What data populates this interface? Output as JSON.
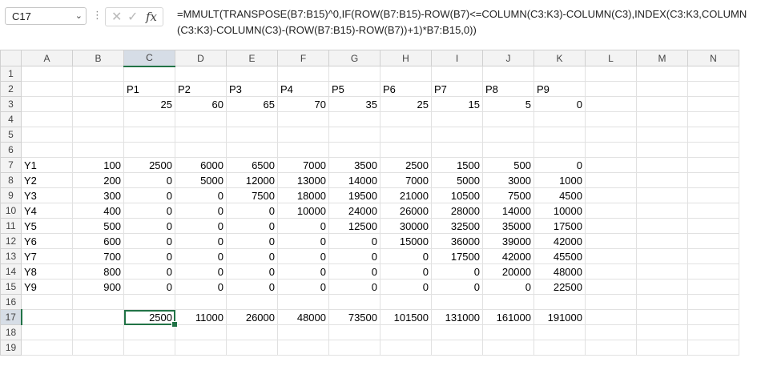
{
  "formula_bar": {
    "name_box": "C17",
    "formula": "=MMULT(TRANSPOSE(B7:B15)^0,IF(ROW(B7:B15)-ROW(B7)<=COLUMN(C3:K3)-COLUMN(C3),INDEX(C3:K3,COLUMN(C3:K3)-COLUMN(C3)-(ROW(B7:B15)-ROW(B7))+1)*B7:B15,0))",
    "fx_label": "fx",
    "cancel_glyph": "✕",
    "enter_glyph": "✓"
  },
  "sheet": {
    "active_cell": "C17",
    "column_headers": [
      "A",
      "B",
      "C",
      "D",
      "E",
      "F",
      "G",
      "H",
      "I",
      "J",
      "K",
      "L",
      "M",
      "N"
    ],
    "rows": [
      {
        "n": "1",
        "cells": [
          "",
          "",
          "",
          "",
          "",
          "",
          "",
          "",
          "",
          "",
          "",
          "",
          "",
          ""
        ]
      },
      {
        "n": "2",
        "cells": [
          "",
          "",
          "P1",
          "P2",
          "P3",
          "P4",
          "P5",
          "P6",
          "P7",
          "P8",
          "P9",
          "",
          "",
          ""
        ]
      },
      {
        "n": "3",
        "cells": [
          "",
          "",
          "25",
          "60",
          "65",
          "70",
          "35",
          "25",
          "15",
          "5",
          "0",
          "",
          "",
          ""
        ]
      },
      {
        "n": "4",
        "cells": [
          "",
          "",
          "",
          "",
          "",
          "",
          "",
          "",
          "",
          "",
          "",
          "",
          "",
          ""
        ]
      },
      {
        "n": "5",
        "cells": [
          "",
          "",
          "",
          "",
          "",
          "",
          "",
          "",
          "",
          "",
          "",
          "",
          "",
          ""
        ]
      },
      {
        "n": "6",
        "cells": [
          "",
          "",
          "",
          "",
          "",
          "",
          "",
          "",
          "",
          "",
          "",
          "",
          "",
          ""
        ]
      },
      {
        "n": "7",
        "cells": [
          "Y1",
          "100",
          "2500",
          "6000",
          "6500",
          "7000",
          "3500",
          "2500",
          "1500",
          "500",
          "0",
          "",
          "",
          ""
        ]
      },
      {
        "n": "8",
        "cells": [
          "Y2",
          "200",
          "0",
          "5000",
          "12000",
          "13000",
          "14000",
          "7000",
          "5000",
          "3000",
          "1000",
          "",
          "",
          ""
        ]
      },
      {
        "n": "9",
        "cells": [
          "Y3",
          "300",
          "0",
          "0",
          "7500",
          "18000",
          "19500",
          "21000",
          "10500",
          "7500",
          "4500",
          "",
          "",
          ""
        ]
      },
      {
        "n": "10",
        "cells": [
          "Y4",
          "400",
          "0",
          "0",
          "0",
          "10000",
          "24000",
          "26000",
          "28000",
          "14000",
          "10000",
          "",
          "",
          ""
        ]
      },
      {
        "n": "11",
        "cells": [
          "Y5",
          "500",
          "0",
          "0",
          "0",
          "0",
          "12500",
          "30000",
          "32500",
          "35000",
          "17500",
          "",
          "",
          ""
        ]
      },
      {
        "n": "12",
        "cells": [
          "Y6",
          "600",
          "0",
          "0",
          "0",
          "0",
          "0",
          "15000",
          "36000",
          "39000",
          "42000",
          "",
          "",
          ""
        ]
      },
      {
        "n": "13",
        "cells": [
          "Y7",
          "700",
          "0",
          "0",
          "0",
          "0",
          "0",
          "0",
          "17500",
          "42000",
          "45500",
          "",
          "",
          ""
        ]
      },
      {
        "n": "14",
        "cells": [
          "Y8",
          "800",
          "0",
          "0",
          "0",
          "0",
          "0",
          "0",
          "0",
          "20000",
          "48000",
          "",
          "",
          ""
        ]
      },
      {
        "n": "15",
        "cells": [
          "Y9",
          "900",
          "0",
          "0",
          "0",
          "0",
          "0",
          "0",
          "0",
          "0",
          "22500",
          "",
          "",
          ""
        ]
      },
      {
        "n": "16",
        "cells": [
          "",
          "",
          "",
          "",
          "",
          "",
          "",
          "",
          "",
          "",
          "",
          "",
          "",
          ""
        ]
      },
      {
        "n": "17",
        "cells": [
          "",
          "",
          "2500",
          "11000",
          "26000",
          "48000",
          "73500",
          "101500",
          "131000",
          "161000",
          "191000",
          "",
          "",
          ""
        ]
      },
      {
        "n": "18",
        "cells": [
          "",
          "",
          "",
          "",
          "",
          "",
          "",
          "",
          "",
          "",
          "",
          "",
          "",
          ""
        ]
      },
      {
        "n": "19",
        "cells": [
          "",
          "",
          "",
          "",
          "",
          "",
          "",
          "",
          "",
          "",
          "",
          "",
          "",
          ""
        ]
      }
    ]
  },
  "colors": {
    "selection_green": "#217346",
    "spill_border_blue": "#2f6fb0",
    "header_bg": "#f3f3f3",
    "selected_header_bg": "#d6dde6"
  }
}
